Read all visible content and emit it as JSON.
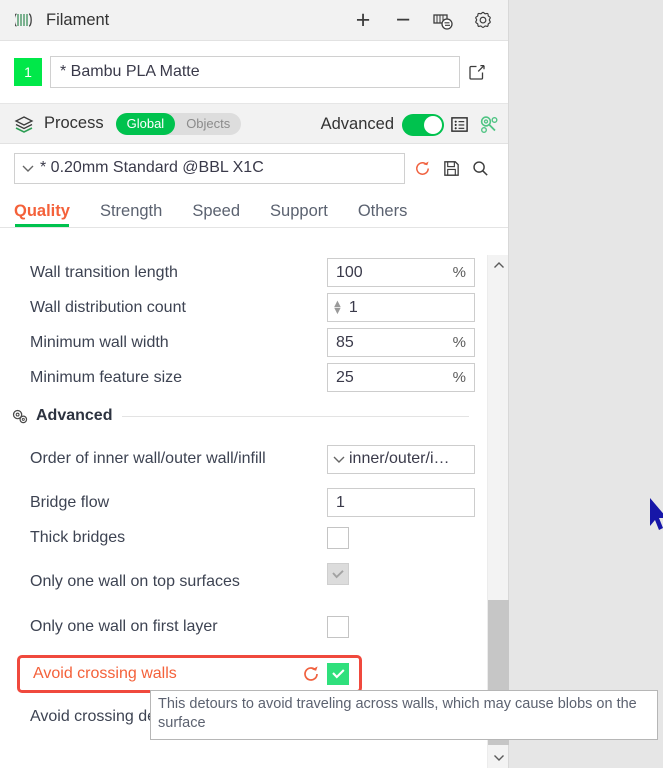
{
  "filament": {
    "icon": "filament-spool-icon",
    "title": "Filament",
    "add_label": "+",
    "remove_label": "−",
    "ams_icon": "filament-swap-icon",
    "settings_icon": "gear-icon",
    "badge": "1",
    "name": "* Bambu PLA Matte",
    "edit_icon": "edit-icon"
  },
  "process": {
    "icon": "layers-icon",
    "title": "Process",
    "scope_global": "Global",
    "scope_objects": "Objects",
    "advanced_label": "Advanced",
    "advanced_on": true,
    "list_icon": "list-icon",
    "compare_icon": "compare-presets-icon",
    "preset": "* 0.20mm Standard @BBL X1C",
    "reset_icon": "reset-icon",
    "save_icon": "save-icon",
    "search_icon": "search-icon"
  },
  "tabs": [
    {
      "label": "Quality",
      "active": true
    },
    {
      "label": "Strength",
      "active": false
    },
    {
      "label": "Speed",
      "active": false
    },
    {
      "label": "Support",
      "active": false
    },
    {
      "label": "Others",
      "active": false
    }
  ],
  "settings": {
    "rows": [
      {
        "label": "Wall transition length",
        "value": "100",
        "unit": "%",
        "type": "field"
      },
      {
        "label": "Wall distribution count",
        "value": "1",
        "unit": "",
        "type": "spinner"
      },
      {
        "label": "Minimum wall width",
        "value": "85",
        "unit": "%",
        "type": "field"
      },
      {
        "label": "Minimum feature size",
        "value": "25",
        "unit": "%",
        "type": "field"
      }
    ],
    "group_advanced": "Advanced",
    "advanced_rows": [
      {
        "label": "Order of inner wall/outer wall/infill",
        "value": "inner/outer/i…",
        "type": "dropdown"
      },
      {
        "label": "Bridge flow",
        "value": "1",
        "unit": "",
        "type": "field"
      },
      {
        "label": "Thick bridges",
        "value": "",
        "type": "checkbox",
        "checked": false,
        "disabled": false
      },
      {
        "label": "Only one wall on top surfaces",
        "value": "",
        "type": "checkbox",
        "checked": true,
        "disabled": true
      },
      {
        "label": "Only one wall on first layer",
        "value": "",
        "type": "checkbox",
        "checked": false,
        "disabled": false
      }
    ],
    "highlighted": {
      "label": "Avoid crossing walls",
      "checked": true,
      "reset_icon": "reset-icon"
    },
    "last_row_label": "Avoid crossing detour length"
  },
  "tooltip": {
    "text": "This detours to avoid traveling across walls, which may cause blobs on the surface"
  },
  "scrollbar": {
    "up_icon": "chevron-up-icon",
    "down_icon": "chevron-down-icon"
  },
  "cursor": {
    "icon": "mouse-cursor-icon"
  },
  "colors": {
    "accent_orange": "#f4613a",
    "accent_green": "#00c24e",
    "checkbox_green": "#2fe07c",
    "highlight_red": "#f0493d",
    "badge_green": "#00e849"
  }
}
